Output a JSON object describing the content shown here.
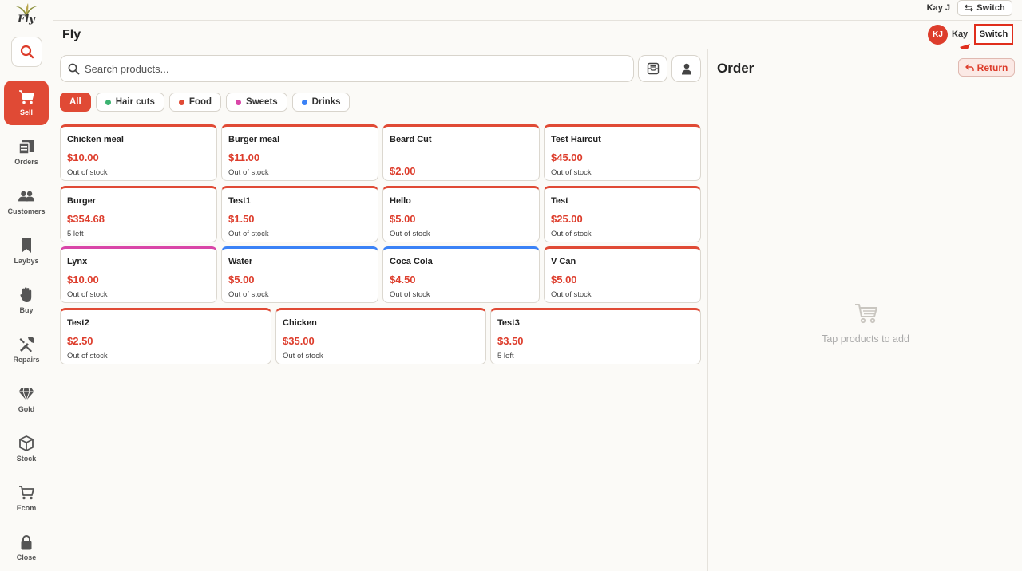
{
  "app": {
    "logo_text": "Fly",
    "title": "Fly"
  },
  "topbar": {
    "user_name": "Kay J",
    "switch_label": "Switch"
  },
  "header": {
    "avatar_initials": "KJ",
    "user_name": "Kay",
    "switch_label": "Switch"
  },
  "sidebar": {
    "items": [
      {
        "label": "Sell",
        "icon": "cart-icon",
        "active": true
      },
      {
        "label": "Orders",
        "icon": "orders-icon"
      },
      {
        "label": "Customers",
        "icon": "customers-icon"
      },
      {
        "label": "Laybys",
        "icon": "bookmark-icon"
      },
      {
        "label": "Buy",
        "icon": "hand-icon"
      },
      {
        "label": "Repairs",
        "icon": "tools-icon"
      },
      {
        "label": "Gold",
        "icon": "diamond-icon"
      },
      {
        "label": "Stock",
        "icon": "box-icon"
      },
      {
        "label": "Ecom",
        "icon": "shop-cart-icon"
      },
      {
        "label": "Close",
        "icon": "lock-icon"
      }
    ]
  },
  "search": {
    "placeholder": "Search products..."
  },
  "categories": [
    {
      "label": "All",
      "active": true
    },
    {
      "label": "Hair cuts",
      "color": "#3cb371"
    },
    {
      "label": "Food",
      "color": "#e04a35"
    },
    {
      "label": "Sweets",
      "color": "#d946a8"
    },
    {
      "label": "Drinks",
      "color": "#3b82f6"
    }
  ],
  "products": [
    {
      "name": "Chicken meal",
      "price": "$10.00",
      "stock": "Out of stock",
      "color": "#e04a35"
    },
    {
      "name": "Burger meal",
      "price": "$11.00",
      "stock": "Out of stock",
      "color": "#e04a35"
    },
    {
      "name": "Beard Cut",
      "price": "$2.00",
      "stock": "",
      "color": "#e04a35"
    },
    {
      "name": "Test Haircut",
      "price": "$45.00",
      "stock": "Out of stock",
      "color": "#e04a35"
    },
    {
      "name": "Burger",
      "price": "$354.68",
      "stock": "5 left",
      "color": "#e04a35"
    },
    {
      "name": "Test1",
      "price": "$1.50",
      "stock": "Out of stock",
      "color": "#e04a35"
    },
    {
      "name": "Hello",
      "price": "$5.00",
      "stock": "Out of stock",
      "color": "#e04a35"
    },
    {
      "name": "Test",
      "price": "$25.00",
      "stock": "Out of stock",
      "color": "#e04a35"
    },
    {
      "name": "Lynx",
      "price": "$10.00",
      "stock": "Out of stock",
      "color": "#d946a8"
    },
    {
      "name": "Water",
      "price": "$5.00",
      "stock": "Out of stock",
      "color": "#3b82f6"
    },
    {
      "name": "Coca Cola",
      "price": "$4.50",
      "stock": "Out of stock",
      "color": "#3b82f6"
    },
    {
      "name": "V Can",
      "price": "$5.00",
      "stock": "Out of stock",
      "color": "#e04a35"
    },
    {
      "name": "Test2",
      "price": "$2.50",
      "stock": "Out of stock",
      "color": "#e04a35"
    },
    {
      "name": "Chicken",
      "price": "$35.00",
      "stock": "Out of stock",
      "color": "#e04a35"
    },
    {
      "name": "Test3",
      "price": "$3.50",
      "stock": "5 left",
      "color": "#e04a35"
    }
  ],
  "order": {
    "title": "Order",
    "return_label": "Return",
    "empty_text": "Tap products to add"
  },
  "colors": {
    "accent": "#e04a35",
    "price": "#dd3d2c"
  }
}
